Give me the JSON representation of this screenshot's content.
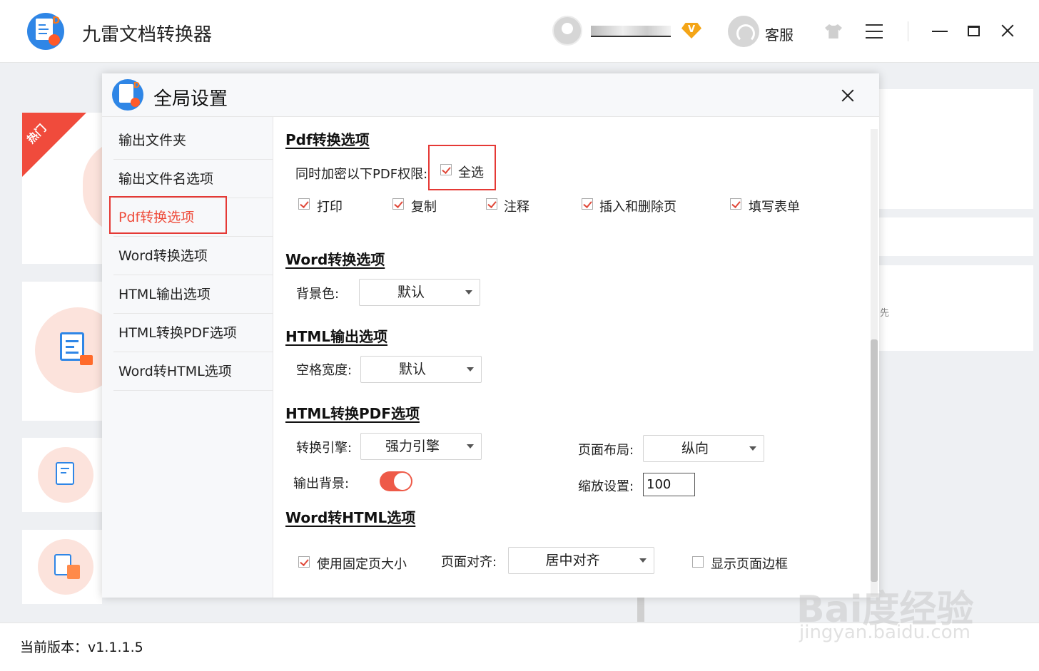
{
  "app": {
    "title": "九雷文档转换器",
    "logo_letter": "D",
    "vip_badge": "V",
    "support_label": "客服",
    "version_label": "当前版本：v1.1.1.5",
    "hot_label": "热门"
  },
  "dialog": {
    "title": "全局设置",
    "logo_letter": "D",
    "nav": [
      {
        "label": "输出文件夹",
        "active": false
      },
      {
        "label": "输出文件名选项",
        "active": false
      },
      {
        "label": "Pdf转换选项",
        "active": true
      },
      {
        "label": "Word转换选项",
        "active": false
      },
      {
        "label": "HTML输出选项",
        "active": false
      },
      {
        "label": "HTML转换PDF选项",
        "active": false
      },
      {
        "label": "Word转HTML选项",
        "active": false
      }
    ],
    "pdf": {
      "title": "Pdf转换选项",
      "encrypt_label": "同时加密以下PDF权限:",
      "select_all": {
        "label": "全选",
        "checked": true
      },
      "permissions": [
        {
          "label": "打印",
          "checked": true
        },
        {
          "label": "复制",
          "checked": true
        },
        {
          "label": "注释",
          "checked": true
        },
        {
          "label": "插入和删除页",
          "checked": true
        },
        {
          "label": "填写表单",
          "checked": true
        }
      ]
    },
    "word": {
      "title": "Word转换选项",
      "bg_label": "背景色:",
      "bg_value": "默认"
    },
    "html_out": {
      "title": "HTML输出选项",
      "space_label": "空格宽度:",
      "space_value": "默认"
    },
    "html_pdf": {
      "title": "HTML转换PDF选项",
      "engine_label": "转换引擎:",
      "engine_value": "强力引擎",
      "layout_label": "页面布局:",
      "layout_value": "纵向",
      "bg_label": "输出背景:",
      "bg_on": true,
      "zoom_label": "缩放设置:",
      "zoom_value": "100"
    },
    "word_html": {
      "title": "Word转HTML选项",
      "fixed_size": {
        "label": "使用固定页大小",
        "checked": true
      },
      "align_label": "页面对齐:",
      "align_value": "居中对齐",
      "show_border": {
        "label": "显示页面边框",
        "checked": false
      }
    }
  },
  "background": {
    "fragment_text": "先"
  },
  "watermark": {
    "main": "Bai度经验",
    "sub": "jingyan.baidu.com"
  }
}
